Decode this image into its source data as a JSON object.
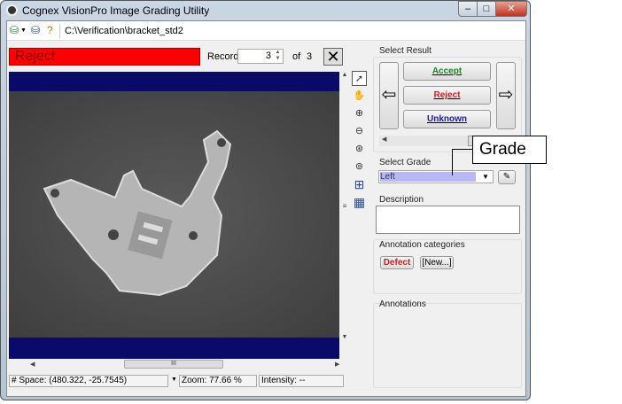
{
  "window": {
    "title": "Cognex VisionPro Image Grading Utility",
    "minimize": "‒",
    "maximize": "□",
    "close": "✕"
  },
  "toolbar": {
    "path": "C:\\Verification\\bracket_std2",
    "icons": [
      "database-open-icon",
      "dropdown-icon",
      "database-settings-icon",
      "help-icon"
    ]
  },
  "header": {
    "result_banner": "Reject",
    "record_label": "Record",
    "record_value": "3",
    "of_label": "of",
    "record_total": "3",
    "close_glyph": "✕",
    "banner_color": "#ff0000"
  },
  "viewer": {
    "scroll_thumb": "III"
  },
  "tools": [
    "pointer-icon",
    "pan-hand-icon",
    "zoom-in-icon",
    "zoom-out-icon",
    "zoom-fit-icon",
    "zoom-actual-icon",
    "grid-icon",
    "fine-grid-icon"
  ],
  "status": {
    "space": "# Space: (480.322, -25.7545)",
    "zoom": "Zoom: 77.66 %",
    "intensity": "Intensity: --"
  },
  "select_result": {
    "label": "Select Result",
    "accept": "Accept",
    "reject": "Reject",
    "unknown": "Unknown",
    "accept_color": "#1a8a1a",
    "reject_color": "#d02020",
    "unknown_color": "#1a1aaa"
  },
  "select_grade": {
    "label": "Select Grade",
    "value": "Left"
  },
  "description": {
    "label": "Description",
    "value": ""
  },
  "annotation_categories": {
    "label": "Annotation categories",
    "defect": "Defect",
    "new": "[New...]"
  },
  "annotations": {
    "label": "Annotations"
  },
  "callout": {
    "text": "Grade"
  }
}
